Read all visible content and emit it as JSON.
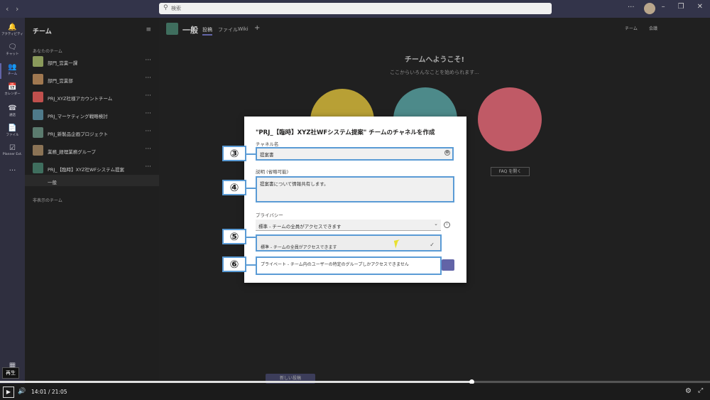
{
  "titlebar": {
    "search_placeholder": "検索"
  },
  "rail": [
    {
      "icon": "bell-icon",
      "label": "アクティビティ"
    },
    {
      "icon": "chat-icon",
      "label": "チャット"
    },
    {
      "icon": "teams-icon",
      "label": "チーム"
    },
    {
      "icon": "calendar-icon",
      "label": "カレンダー"
    },
    {
      "icon": "phone-icon",
      "label": "通話"
    },
    {
      "icon": "files-icon",
      "label": "ファイル"
    },
    {
      "icon": "planner-icon",
      "label": "Planner Ext."
    }
  ],
  "teampanel": {
    "header": "チーム",
    "section_mine": "あなたのチーム",
    "section_hidden": "非表示のチーム",
    "teams": [
      {
        "name": "部門_営業一課",
        "color": "#8a9a5b"
      },
      {
        "name": "部門_営業部",
        "color": "#a07850"
      },
      {
        "name": "PRJ_XYZ社様アカウントチーム",
        "color": "#c0504d"
      },
      {
        "name": "PRJ_マーケティング戦略検討",
        "color": "#4f7a8a"
      },
      {
        "name": "PRJ_新製品企画プロジェクト",
        "color": "#5b7b6e"
      },
      {
        "name": "業務_経理業務グループ",
        "color": "#8b7355"
      },
      {
        "name": "PRJ_【臨時】XYZ社WFシステム提案",
        "color": "#3f6e5e"
      }
    ],
    "channel": "一般"
  },
  "main": {
    "channel_name": "一般",
    "tabs": [
      "投稿",
      "ファイル",
      "Wiki"
    ],
    "add_tab": "+",
    "team_btn": "チーム",
    "meet_btn": "会議",
    "welcome_title": "チームへようこそ!",
    "welcome_sub": "ここからいろんなことを始められます...",
    "faq_btn": "FAQ を開く",
    "new_post": "新しい投稿"
  },
  "dialog": {
    "title": "\"PRJ_【臨時】XYZ社WFシステム提案\" チームのチャネルを作成",
    "name_label": "チャネル名",
    "name_value": "提案書",
    "desc_label": "説明 (省略可能)",
    "desc_value": "提案書について情報共有します。",
    "privacy_label": "プライバシー",
    "privacy_selected": "標準 - チームの全員がアクセスできます",
    "options": [
      "標準 - チームの全員がアクセスできます",
      "プライベート - チーム内のユーザーの特定のグループしかアクセスできません"
    ]
  },
  "badges": [
    "③",
    "④",
    "⑤",
    "⑥"
  ],
  "player": {
    "time": "14:01  /  21:05",
    "progress": 0.664,
    "tooltip": "再生"
  }
}
